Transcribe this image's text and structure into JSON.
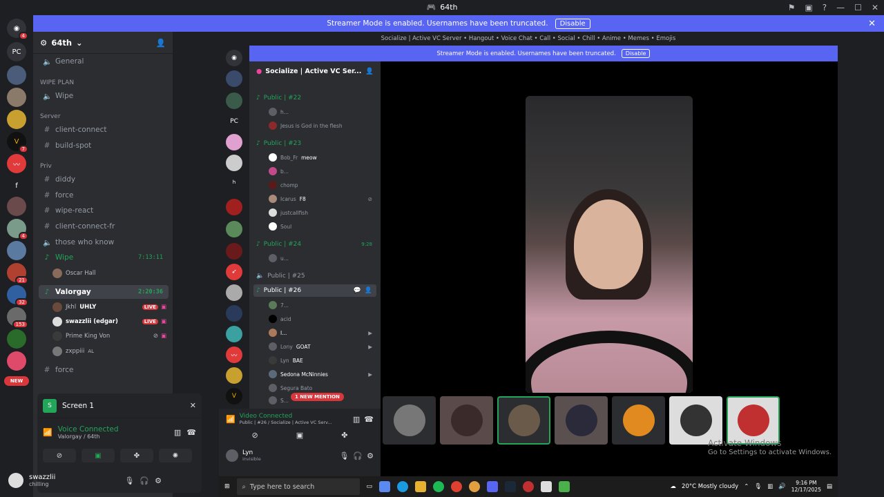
{
  "window": {
    "title": "64th"
  },
  "banner": {
    "text": "Streamer Mode is enabled. Usernames have been truncated.",
    "disable": "Disable"
  },
  "guilds": [
    {
      "label": "PC"
    },
    {
      "label": "f"
    },
    {
      "label": "NEW"
    }
  ],
  "guild_badges": [
    "4",
    "1",
    "7",
    "4",
    "21",
    "32",
    "153"
  ],
  "server": {
    "name": "64th"
  },
  "channels": {
    "general": "General",
    "wipe_plan_cat": "WIPE PLAN",
    "wipe": "Wipe",
    "server_cat": "Server",
    "client_connect": "client-connect",
    "build_spot": "build-spot",
    "priv_cat": "Priv",
    "diddy": "diddy",
    "force": "force",
    "wipe_react": "wipe-react",
    "client_connect_fr": "client-connect-fr",
    "those_who_know": "those who know",
    "wipe_voice": "Wipe",
    "wipe_time": "7:13:11",
    "oscar": "Oscar Hall",
    "valorgay": "Valorgay",
    "valorgay_time": "2:20:36",
    "force2": "force"
  },
  "voice_users": [
    {
      "name": "Jkhl",
      "tag": "UHLY",
      "live": "LIVE"
    },
    {
      "name": "swazzlii (edgar)",
      "live": "LIVE"
    },
    {
      "name": "Prime King Von"
    },
    {
      "name": "zxppiii",
      "tag": "AL"
    }
  ],
  "voice_panel": {
    "screen": "Screen 1",
    "status": "Voice Connected",
    "where": "Valorgay / 64th"
  },
  "me": {
    "name": "swazzlii",
    "status": "chilling"
  },
  "inner": {
    "title": "Socialize | Active VC Server • Hangout • Voice Chat • Call • Social • Chill • Anime • Memes • Emojis",
    "server": "Socialize | Active VC Ser...",
    "guild_pc": "PC",
    "guild_h": "h",
    "channels": [
      {
        "name": "Public | #22"
      },
      {
        "name": "Public | #23"
      },
      {
        "name": "Public | #24",
        "time": "9:28"
      },
      {
        "name": "Public | #25"
      },
      {
        "name": "Public | #26"
      }
    ],
    "users22": [
      "h...",
      "Jesus is God in the flesh"
    ],
    "users23": [
      "Bob_Fr",
      "b...",
      "chomp",
      "Icarus",
      "justcallfish",
      "Soul"
    ],
    "users23_tags": {
      "bob": "meow",
      "icarus": "F8"
    },
    "users24": [
      "u..."
    ],
    "users26": [
      "7...",
      "acid",
      "I...",
      "Lony",
      "Lyn",
      "Sedona McNinnies",
      "Segura Bato",
      "S..."
    ],
    "users26_tags": {
      "lony": "GOAT",
      "lyn": "BAE"
    },
    "mention": "1 NEW MENTION",
    "video_status": "Video Connected",
    "video_where": "Public | #26 / Socialize | Active VC Serv...",
    "me": {
      "name": "Lyn",
      "status": "invisible"
    },
    "watermark1": "Activate Windows",
    "watermark2": "Go to Settings to activate Windows.",
    "taskbar": {
      "search": "Type here to search",
      "weather": "20°C  Mostly cloudy",
      "time": "9:16 PM",
      "date": "12/17/2025"
    }
  }
}
